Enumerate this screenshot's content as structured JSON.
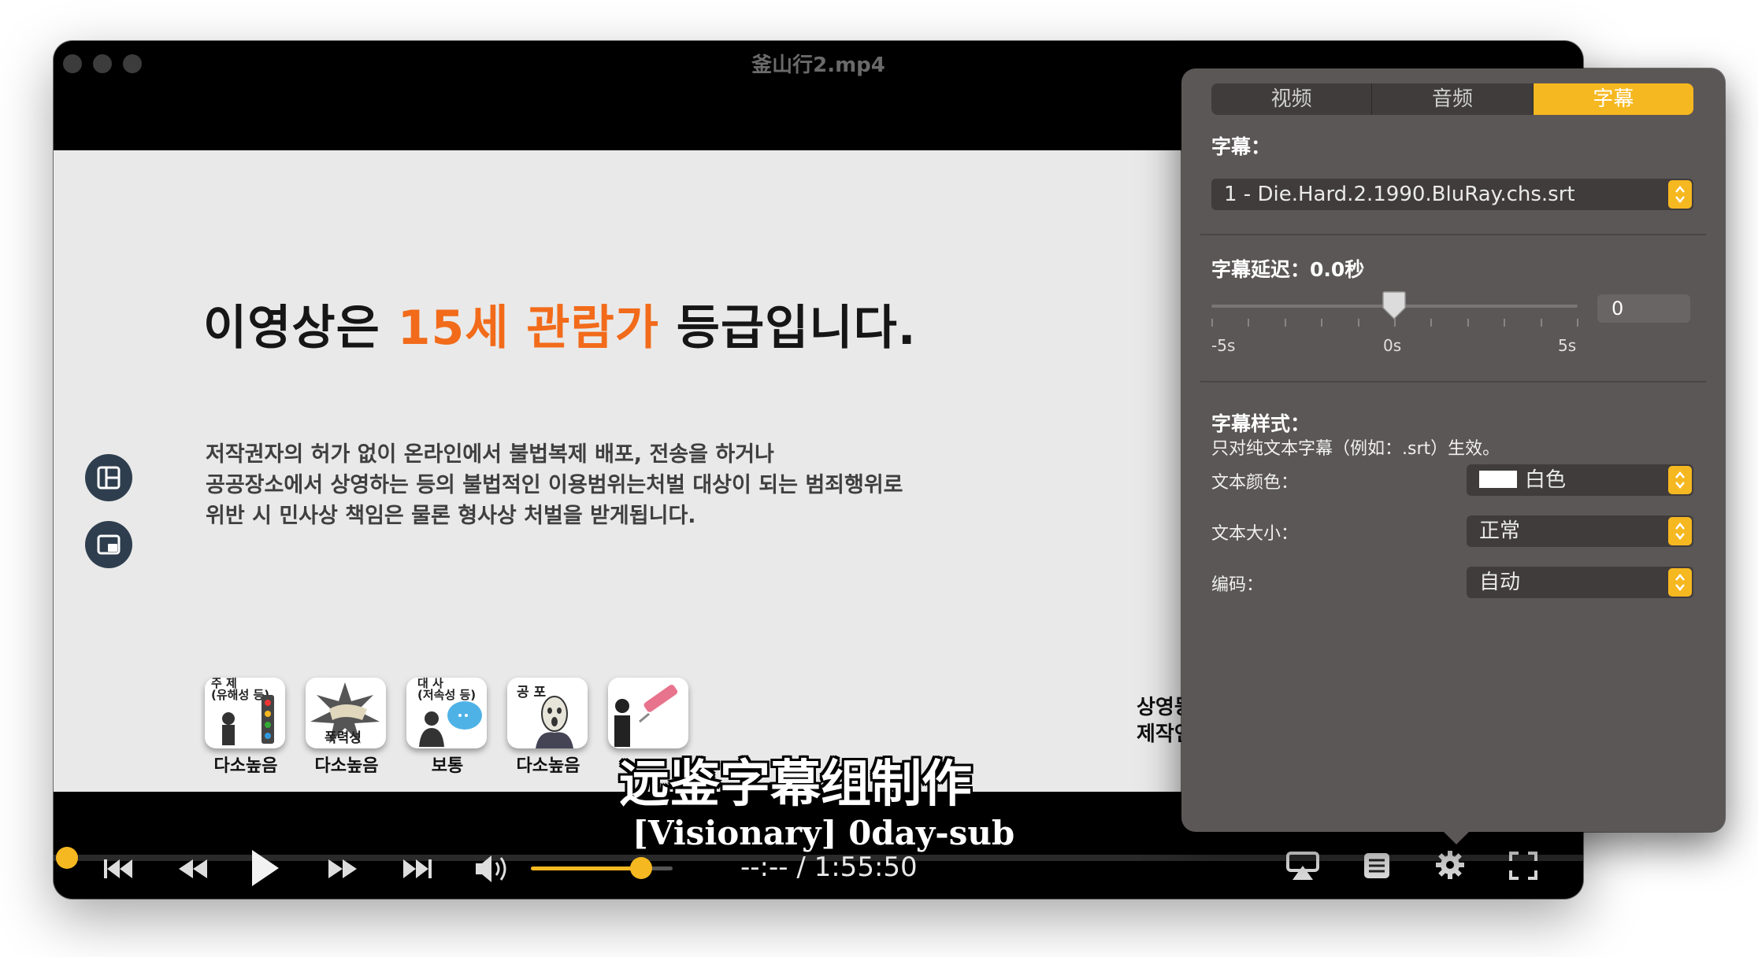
{
  "window": {
    "title": "釜山行2.mp4"
  },
  "video": {
    "headline_prefix": "이영상은 ",
    "headline_highlight": "15세 관람가",
    "headline_suffix": " 등급입니다.",
    "notice_lines": [
      "저작권자의 허가 없이 온라인에서 불법복제 배포, 전송을 하거나",
      "공공장소에서 상영하는 등의 불법적인 이용범위는처벌 대상이 되는 범죄행위로",
      "위반 시 민사상 책임은 물론 형사상 처벌을 받게됩니다."
    ],
    "categories": [
      {
        "title": "주 제\n(유해성 등)",
        "inner": "",
        "label": "다소높음"
      },
      {
        "title": "",
        "inner": "폭력성",
        "label": "다소높음"
      },
      {
        "title": "대 사\n(저속성 등)",
        "inner": "",
        "label": "보통"
      },
      {
        "title": "공 포",
        "inner": "",
        "label": "다소높음"
      },
      {
        "title": "",
        "inner": "",
        "label": ""
      }
    ],
    "producer_lines": [
      "상영등",
      "제작연"
    ],
    "subtitle_line1": "远鉴字幕组制作",
    "subtitle_line2": "[Visionary] 0day-sub"
  },
  "playback": {
    "progress_fraction": 0.0,
    "volume_fraction": 0.78,
    "time": "--:-- / 1:55:50",
    "accent_color": "#f6b820"
  },
  "controls_icons": [
    "skip-back-icon",
    "rewind-icon",
    "play-icon",
    "fast-forward-icon",
    "skip-forward-icon",
    "volume-icon",
    "airplay-icon",
    "playlist-icon",
    "gear-icon",
    "fullscreen-icon"
  ],
  "settings": {
    "tabs": [
      {
        "label": "视频",
        "active": false
      },
      {
        "label": "音频",
        "active": false
      },
      {
        "label": "字幕",
        "active": true
      }
    ],
    "subtitle_label": "字幕：",
    "subtitle_track": "1 - Die.Hard.2.1990.BluRay.chs.srt",
    "delay_label": "字幕延迟：0.0秒",
    "delay_field": "0",
    "delay_min_label": "-5s",
    "delay_mid_label": "0s",
    "delay_max_label": "5s",
    "delay_value_seconds": 0.0,
    "delay_range": [
      -5,
      5
    ],
    "style_title": "字幕样式：",
    "style_note": "只对纯文本字幕（例如：.srt）生效。",
    "text_color_label": "文本颜色：",
    "text_color_value": "白色",
    "text_size_label": "文本大小：",
    "text_size_value": "正常",
    "encoding_label": "编码：",
    "encoding_value": "自动"
  }
}
